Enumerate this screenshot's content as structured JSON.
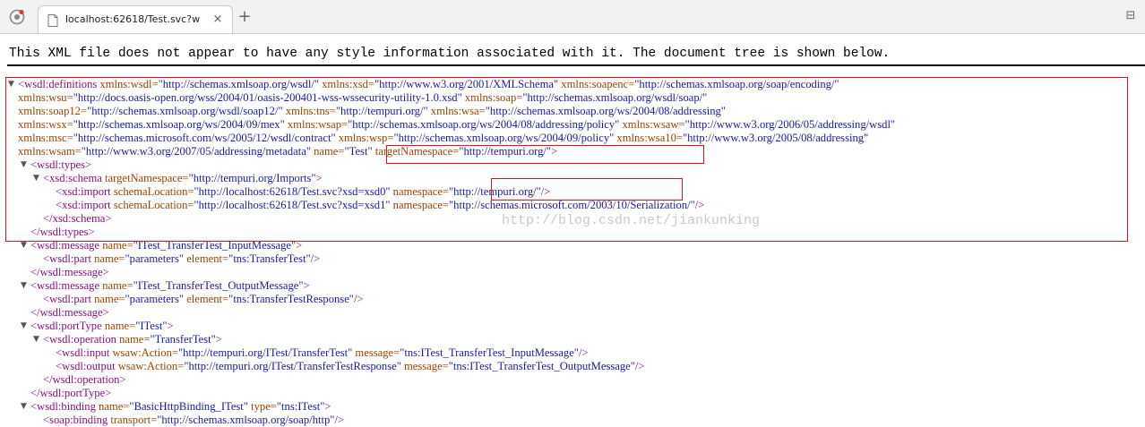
{
  "browser": {
    "tab_title": "localhost:62618/Test.svc?wsdl",
    "tab_close": "×",
    "new_tab": "+",
    "menu": "⊟"
  },
  "page": {
    "info_text": "This XML file does not appear to have any style information associated with it. The document tree is shown below.",
    "watermark": "http://blog.csdn.net/jiankunking"
  },
  "xml_lines": [
    {
      "expand": "▼",
      "parts": [
        {
          "t": "tag",
          "v": "<wsdl:definitions"
        },
        {
          "t": "an",
          "v": " xmlns:wsdl="
        },
        {
          "t": "av",
          "v": "\"http://schemas.xmlsoap.org/wsdl/\""
        },
        {
          "t": "an",
          "v": " xmlns:xsd="
        },
        {
          "t": "av",
          "v": "\"http://www.w3.org/2001/XMLSchema\""
        },
        {
          "t": "an",
          "v": " xmlns:soapenc="
        },
        {
          "t": "av",
          "v": "\"http://schemas.xmlsoap.org/soap/encoding/\""
        }
      ]
    },
    {
      "expand": "",
      "parts": [
        {
          "t": "an",
          "v": "xmlns:wsu="
        },
        {
          "t": "av",
          "v": "\"http://docs.oasis-open.org/wss/2004/01/oasis-200401-wss-wssecurity-utility-1.0.xsd\""
        },
        {
          "t": "an",
          "v": " xmlns:soap="
        },
        {
          "t": "av",
          "v": "\"http://schemas.xmlsoap.org/wsdl/soap/\""
        }
      ]
    },
    {
      "expand": "",
      "parts": [
        {
          "t": "an",
          "v": "xmlns:soap12="
        },
        {
          "t": "av",
          "v": "\"http://schemas.xmlsoap.org/wsdl/soap12/\""
        },
        {
          "t": "an",
          "v": " xmlns:tns="
        },
        {
          "t": "av",
          "v": "\"http://tempuri.org/\""
        },
        {
          "t": "an",
          "v": " xmlns:wsa="
        },
        {
          "t": "av",
          "v": "\"http://schemas.xmlsoap.org/ws/2004/08/addressing\""
        }
      ]
    },
    {
      "expand": "",
      "parts": [
        {
          "t": "an",
          "v": "xmlns:wsx="
        },
        {
          "t": "av",
          "v": "\"http://schemas.xmlsoap.org/ws/2004/09/mex\""
        },
        {
          "t": "an",
          "v": " xmlns:wsap="
        },
        {
          "t": "av",
          "v": "\"http://schemas.xmlsoap.org/ws/2004/08/addressing/policy\""
        },
        {
          "t": "an",
          "v": " xmlns:wsaw="
        },
        {
          "t": "av",
          "v": "\"http://www.w3.org/2006/05/addressing/wsdl\""
        }
      ]
    },
    {
      "expand": "",
      "parts": [
        {
          "t": "an",
          "v": "xmlns:msc="
        },
        {
          "t": "av",
          "v": "\"http://schemas.microsoft.com/ws/2005/12/wsdl/contract\""
        },
        {
          "t": "an",
          "v": " xmlns:wsp="
        },
        {
          "t": "av",
          "v": "\"http://schemas.xmlsoap.org/ws/2004/09/policy\""
        },
        {
          "t": "an",
          "v": " xmlns:wsa10="
        },
        {
          "t": "av",
          "v": "\"http://www.w3.org/2005/08/addressing\""
        }
      ]
    },
    {
      "expand": "",
      "parts": [
        {
          "t": "an",
          "v": "xmlns:wsam="
        },
        {
          "t": "av",
          "v": "\"http://www.w3.org/2007/05/addressing/metadata\""
        },
        {
          "t": "an",
          "v": " name="
        },
        {
          "t": "av",
          "v": "\"Test\""
        },
        {
          "t": "an",
          "v": " targetNamespace="
        },
        {
          "t": "av",
          "v": "\"http://tempuri.org/\""
        },
        {
          "t": "tag",
          "v": ">"
        }
      ]
    },
    {
      "expand": "▼",
      "parts": [
        {
          "t": "tag",
          "v": "<wsdl:types>"
        }
      ]
    },
    {
      "expand": "▼",
      "parts": [
        {
          "t": "tag",
          "v": "<xsd:schema"
        },
        {
          "t": "an",
          "v": " targetNamespace="
        },
        {
          "t": "av",
          "v": "\"http://tempuri.org/Imports\""
        },
        {
          "t": "tag",
          "v": ">"
        }
      ]
    },
    {
      "expand": "",
      "parts": [
        {
          "t": "tag",
          "v": "<xsd:import"
        },
        {
          "t": "an",
          "v": " schemaLocation="
        },
        {
          "t": "av",
          "v": "\"http://localhost:62618/Test.svc?xsd=xsd0\""
        },
        {
          "t": "an",
          "v": " namespace="
        },
        {
          "t": "av",
          "v": "\"http://tempuri.org/\""
        },
        {
          "t": "tag",
          "v": "/>"
        }
      ]
    },
    {
      "expand": "",
      "parts": [
        {
          "t": "tag",
          "v": "<xsd:import"
        },
        {
          "t": "an",
          "v": " schemaLocation="
        },
        {
          "t": "av",
          "v": "\"http://localhost:62618/Test.svc?xsd=xsd1\""
        },
        {
          "t": "an",
          "v": " namespace="
        },
        {
          "t": "av",
          "v": "\"http://schemas.microsoft.com/2003/10/Serialization/\""
        },
        {
          "t": "tag",
          "v": "/>"
        }
      ]
    },
    {
      "expand": "",
      "parts": [
        {
          "t": "tag",
          "v": "</xsd:schema>"
        }
      ]
    },
    {
      "expand": "",
      "parts": [
        {
          "t": "tag",
          "v": "</wsdl:types>"
        }
      ]
    },
    {
      "expand": "▼",
      "parts": [
        {
          "t": "tag",
          "v": "<wsdl:message"
        },
        {
          "t": "an",
          "v": " name="
        },
        {
          "t": "av",
          "v": "\"ITest_TransferTest_InputMessage\""
        },
        {
          "t": "tag",
          "v": ">"
        }
      ]
    },
    {
      "expand": "",
      "parts": [
        {
          "t": "tag",
          "v": "<wsdl:part"
        },
        {
          "t": "an",
          "v": " name="
        },
        {
          "t": "av",
          "v": "\"parameters\""
        },
        {
          "t": "an",
          "v": " element="
        },
        {
          "t": "av",
          "v": "\"tns:TransferTest\""
        },
        {
          "t": "tag",
          "v": "/>"
        }
      ]
    },
    {
      "expand": "",
      "parts": [
        {
          "t": "tag",
          "v": "</wsdl:message>"
        }
      ]
    },
    {
      "expand": "▼",
      "parts": [
        {
          "t": "tag",
          "v": "<wsdl:message"
        },
        {
          "t": "an",
          "v": " name="
        },
        {
          "t": "av",
          "v": "\"ITest_TransferTest_OutputMessage\""
        },
        {
          "t": "tag",
          "v": ">"
        }
      ]
    },
    {
      "expand": "",
      "parts": [
        {
          "t": "tag",
          "v": "<wsdl:part"
        },
        {
          "t": "an",
          "v": " name="
        },
        {
          "t": "av",
          "v": "\"parameters\""
        },
        {
          "t": "an",
          "v": " element="
        },
        {
          "t": "av",
          "v": "\"tns:TransferTestResponse\""
        },
        {
          "t": "tag",
          "v": "/>"
        }
      ]
    },
    {
      "expand": "",
      "parts": [
        {
          "t": "tag",
          "v": "</wsdl:message>"
        }
      ]
    },
    {
      "expand": "▼",
      "parts": [
        {
          "t": "tag",
          "v": "<wsdl:portType"
        },
        {
          "t": "an",
          "v": " name="
        },
        {
          "t": "av",
          "v": "\"ITest\""
        },
        {
          "t": "tag",
          "v": ">"
        }
      ]
    },
    {
      "expand": "▼",
      "parts": [
        {
          "t": "tag",
          "v": "<wsdl:operation"
        },
        {
          "t": "an",
          "v": " name="
        },
        {
          "t": "av",
          "v": "\"TransferTest\""
        },
        {
          "t": "tag",
          "v": ">"
        }
      ]
    },
    {
      "expand": "",
      "parts": [
        {
          "t": "tag",
          "v": "<wsdl:input"
        },
        {
          "t": "an",
          "v": " wsaw:Action="
        },
        {
          "t": "av",
          "v": "\"http://tempuri.org/ITest/TransferTest\""
        },
        {
          "t": "an",
          "v": " message="
        },
        {
          "t": "av",
          "v": "\"tns:ITest_TransferTest_InputMessage\""
        },
        {
          "t": "tag",
          "v": "/>"
        }
      ]
    },
    {
      "expand": "",
      "parts": [
        {
          "t": "tag",
          "v": "<wsdl:output"
        },
        {
          "t": "an",
          "v": " wsaw:Action="
        },
        {
          "t": "av",
          "v": "\"http://tempuri.org/ITest/TransferTestResponse\""
        },
        {
          "t": "an",
          "v": " message="
        },
        {
          "t": "av",
          "v": "\"tns:ITest_TransferTest_OutputMessage\""
        },
        {
          "t": "tag",
          "v": "/>"
        }
      ]
    },
    {
      "expand": "",
      "parts": [
        {
          "t": "tag",
          "v": "</wsdl:operation>"
        }
      ]
    },
    {
      "expand": "",
      "parts": [
        {
          "t": "tag",
          "v": "</wsdl:portType>"
        }
      ]
    },
    {
      "expand": "▼",
      "parts": [
        {
          "t": "tag",
          "v": "<wsdl:binding"
        },
        {
          "t": "an",
          "v": " name="
        },
        {
          "t": "av",
          "v": "\"BasicHttpBinding_ITest\""
        },
        {
          "t": "an",
          "v": " type="
        },
        {
          "t": "av",
          "v": "\"tns:ITest\""
        },
        {
          "t": "tag",
          "v": ">"
        }
      ]
    },
    {
      "expand": "",
      "parts": [
        {
          "t": "tag",
          "v": "<soap:binding"
        },
        {
          "t": "an",
          "v": " transport="
        },
        {
          "t": "av",
          "v": "\"http://schemas.xmlsoap.org/soap/http\""
        },
        {
          "t": "tag",
          "v": "/>"
        }
      ]
    }
  ],
  "colors": {
    "tag": "#881280",
    "attr_name": "#994500",
    "attr_value": "#1a1aa6",
    "highlight_box": "#e0141e"
  }
}
